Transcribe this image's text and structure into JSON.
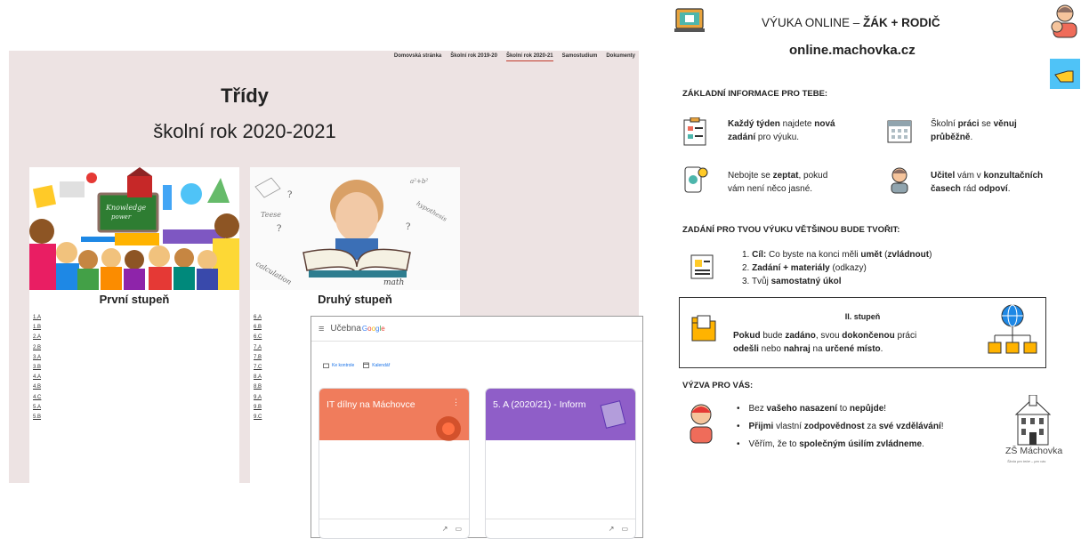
{
  "site": {
    "nav": [
      "Domovská stránka",
      "Školní rok 2019-20",
      "Školní rok 2020-21",
      "Samostudium",
      "Dokumenty"
    ],
    "title": "Třídy",
    "subtitle": "školní rok 2020-2021",
    "grade1": {
      "heading": "První stupeň",
      "classes": [
        "1.A",
        "1.B",
        "2.A",
        "2.B",
        "3.A",
        "3.B",
        "4.A",
        "4.B",
        "4.C",
        "5.A",
        "5.B"
      ]
    },
    "grade2": {
      "heading": "Druhý stupeň",
      "classes": [
        "6.A",
        "6.B",
        "6.C",
        "7.A",
        "7.B",
        "7.C",
        "8.A",
        "8.B",
        "9.A",
        "9.B",
        "9.C"
      ]
    }
  },
  "classroom": {
    "app_name": "Učebna",
    "brand": "Google",
    "links": [
      "Ke kontrole",
      "Kalendář"
    ],
    "cards": [
      {
        "name": "IT dílny na Máchovce",
        "color": "#f07c5c"
      },
      {
        "name": "5. A (2020/21) - Inform",
        "color": "#8f5ec8"
      }
    ]
  },
  "sheet": {
    "title_plain": "VÝUKA ONLINE – ",
    "title_bold": "ŽÁK + RODIČ",
    "url": "online.machovka.cz",
    "sections": {
      "basic": "ZÁKLADNÍ INFORMACE PRO TEBE:",
      "tasks": "ZADÁNÍ PRO TVOU VÝUKU VĚTŠINOU BUDE TVOŘIT:",
      "challenge": "VÝZVA PRO VÁS:"
    },
    "basic_items": [
      {
        "line1": [
          "Každý týden",
          " najdete ",
          "nová"
        ],
        "line2": [
          "zadání",
          " pro výuku."
        ]
      },
      {
        "line1": [
          "",
          "Školní ",
          "práci",
          " se ",
          "věnuj"
        ],
        "line2": [
          "průběžně",
          "."
        ]
      },
      {
        "line1": [
          "",
          "Nebojte se ",
          "zeptat",
          ", pokud"
        ],
        "line2": [
          "",
          "vám není něco jasné."
        ]
      },
      {
        "line1": [
          "Učitel",
          " vám v ",
          "konzultačních"
        ],
        "line2": [
          "časech",
          " rád ",
          "odpoví",
          "."
        ]
      }
    ],
    "numbered": [
      [
        "1.  ",
        "Cíl:",
        " Co byste na konci měli ",
        "umět",
        " (",
        "zvládnout",
        ")"
      ],
      [
        "2.  ",
        "Zadání + materiály",
        " (odkazy)"
      ],
      [
        "3.  ",
        "Tvůj ",
        "samostatný úkol"
      ]
    ],
    "stupen_box": {
      "head": "II. stupeň",
      "line1": [
        "Pokud",
        " bude ",
        "zadáno",
        ", svou ",
        "dokončenou",
        " práci"
      ],
      "line2": [
        "odešli",
        " nebo ",
        "nahraj",
        " na ",
        "určené místo",
        "."
      ]
    },
    "bullets": [
      [
        "Bez ",
        "vašeho nasazení",
        " to ",
        "nepůjde",
        "!"
      ],
      [
        "Přijmi",
        " vlastní ",
        "zodpovědnost",
        " za ",
        "své vzdělávání",
        "!"
      ],
      [
        "Věřím, že to ",
        "společným úsilím",
        " ",
        "zvládneme",
        "."
      ]
    ],
    "school_name": "ZŠ Máchovka",
    "school_motto": "Škola pro tebe – pro vás"
  }
}
